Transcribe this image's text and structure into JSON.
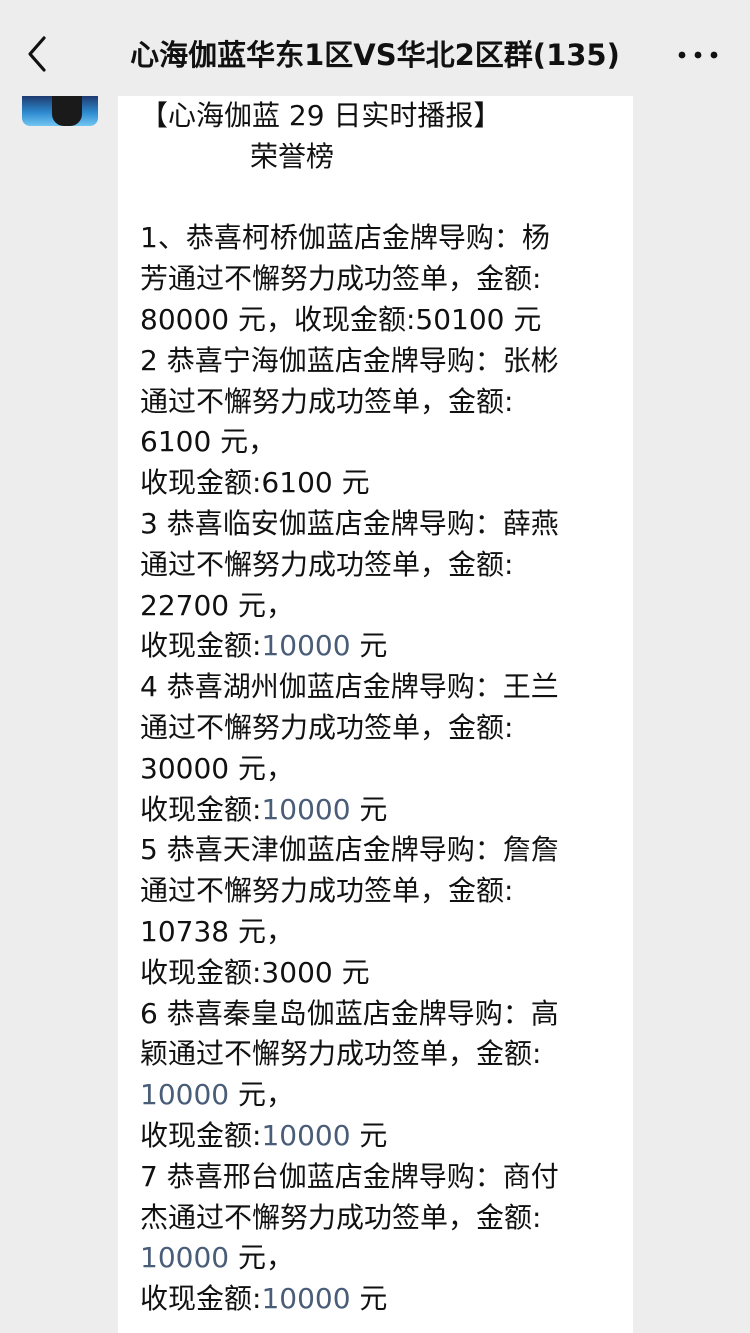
{
  "header": {
    "title": "心海伽蓝华东1区VS华北2区群(135)"
  },
  "message": {
    "heading": "【心海伽蓝 29 日实时播报】",
    "subheading": "荣誉榜",
    "entries": [
      {
        "lines": [
          "1、恭喜柯桥伽蓝店金牌导购：杨",
          "芳通过不懈努力成功签单，金额:",
          "80000 元，收现金额:50100 元"
        ],
        "link_values": []
      },
      {
        "lines": [
          "2 恭喜宁海伽蓝店金牌导购：张彬",
          "通过不懈努力成功签单，金额:",
          "6100 元，",
          "收现金额:6100 元"
        ],
        "link_values": []
      },
      {
        "lines": [
          "3 恭喜临安伽蓝店金牌导购：薛燕",
          "通过不懈努力成功签单，金额:",
          "22700 元，"
        ],
        "cash_prefix": "收现金额:",
        "cash_value": "10000",
        "cash_suffix": " 元"
      },
      {
        "lines": [
          "4 恭喜湖州伽蓝店金牌导购：王兰",
          "通过不懈努力成功签单，金额:",
          "30000 元，"
        ],
        "cash_prefix": "收现金额:",
        "cash_value": "10000",
        "cash_suffix": " 元"
      },
      {
        "lines": [
          "5 恭喜天津伽蓝店金牌导购：詹詹",
          "通过不懈努力成功签单，金额:",
          "10738 元，",
          "收现金额:3000 元"
        ]
      },
      {
        "lines": [
          "6 恭喜秦皇岛伽蓝店金牌导购：高",
          "颖通过不懈努力成功签单，金额:"
        ],
        "amount_value": "10000",
        "amount_suffix": " 元，",
        "cash_prefix": "收现金额:",
        "cash_value": "10000",
        "cash_suffix": " 元"
      },
      {
        "lines": [
          "7 恭喜邢台伽蓝店金牌导购：商付",
          "杰通过不懈努力成功签单，金额:"
        ],
        "amount_value": "10000",
        "amount_suffix": " 元，",
        "cash_prefix": "收现金额:",
        "cash_value": "10000",
        "cash_suffix": " 元"
      }
    ]
  },
  "icons": {
    "back": "chevron-left-icon",
    "more": "more-dots-icon"
  },
  "colors": {
    "background": "#ededed",
    "bubble": "#ffffff",
    "number_link": "#4a5d78"
  }
}
